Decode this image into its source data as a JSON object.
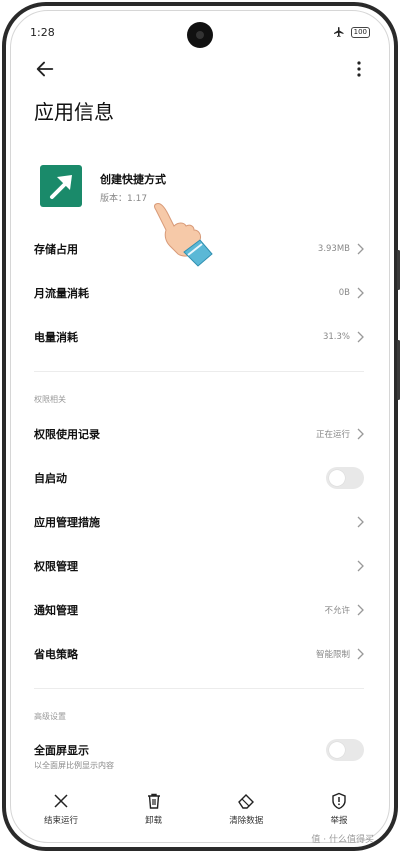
{
  "status_bar": {
    "time": "1:28",
    "battery": "100"
  },
  "header": {
    "title": "应用信息"
  },
  "app": {
    "name": "创建快捷方式",
    "version": "版本：1.17",
    "icon_color": "#1a8a6a"
  },
  "rows_top": [
    {
      "label": "存储占用",
      "value": "3.93MB"
    },
    {
      "label": "月流量消耗",
      "value": "0B"
    },
    {
      "label": "电量消耗",
      "value": "31.3%"
    }
  ],
  "section_permissions": {
    "label": "权限相关",
    "rows": [
      {
        "label": "权限使用记录",
        "value": "正在运行"
      },
      {
        "label": "自启动",
        "toggle": false
      },
      {
        "label": "应用管理措施",
        "value": ""
      },
      {
        "label": "权限管理",
        "value": ""
      },
      {
        "label": "通知管理",
        "value": "不允许"
      },
      {
        "label": "省电策略",
        "value": "智能限制"
      }
    ]
  },
  "section_advanced": {
    "label": "高级设置",
    "rows": [
      {
        "label": "全面屏显示",
        "sub": "以全面屏比例显示内容",
        "toggle": false
      }
    ]
  },
  "bottom_nav": [
    {
      "label": "结束运行",
      "icon": "close-icon"
    },
    {
      "label": "卸载",
      "icon": "trash-icon"
    },
    {
      "label": "清除数据",
      "icon": "eraser-icon"
    },
    {
      "label": "举报",
      "icon": "shield-alert-icon"
    }
  ],
  "watermark": "值 · 什么值得买"
}
